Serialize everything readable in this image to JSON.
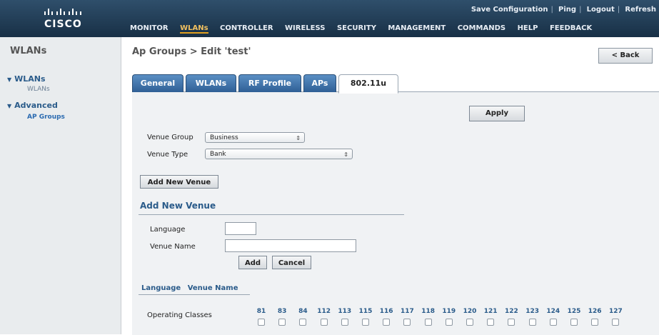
{
  "header": {
    "logo_text": "CISCO",
    "toplinks": [
      "Save Configuration",
      "Ping",
      "Logout",
      "Refresh"
    ],
    "nav": [
      "MONITOR",
      "WLANs",
      "CONTROLLER",
      "WIRELESS",
      "SECURITY",
      "MANAGEMENT",
      "COMMANDS",
      "HELP",
      "FEEDBACK"
    ],
    "active_nav": "WLANs"
  },
  "sidebar": {
    "title": "WLANs",
    "sections": [
      {
        "label": "WLANs",
        "items": [
          "WLANs"
        ]
      },
      {
        "label": "Advanced",
        "items": [
          "AP Groups"
        ]
      }
    ]
  },
  "page": {
    "title": "Ap Groups > Edit  'test'",
    "back_label": "< Back",
    "tabs": [
      "General",
      "WLANs",
      "RF Profile",
      "APs",
      "802.11u"
    ],
    "active_tab": "802.11u",
    "apply_label": "Apply",
    "venue_group_label": "Venue Group",
    "venue_group_value": "Business",
    "venue_type_label": "Venue Type",
    "venue_type_value": "Bank",
    "add_new_venue_button": "Add New Venue",
    "add_new_venue_title": "Add New Venue",
    "language_label": "Language",
    "language_value": "",
    "venue_name_label": "Venue Name",
    "venue_name_value": "",
    "add_label": "Add",
    "cancel_label": "Cancel",
    "list_headers": [
      "Language",
      "Venue Name"
    ],
    "operating_classes_label": "Operating Classes",
    "operating_classes": [
      "81",
      "83",
      "84",
      "112",
      "113",
      "115",
      "116",
      "117",
      "118",
      "119",
      "120",
      "121",
      "122",
      "123",
      "124",
      "125",
      "126",
      "127"
    ]
  },
  "colors": {
    "header_bg": "#1f3a55",
    "accent": "#2a5b8a",
    "active_nav": "#f0c060"
  }
}
